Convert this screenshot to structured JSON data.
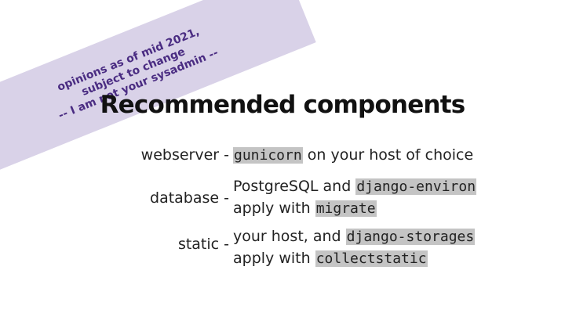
{
  "banner": {
    "line1": "opinions as of mid 2021,",
    "line2": "subject to change",
    "line3": "-- I am not your sysadmin --"
  },
  "title": "Recommended components",
  "rows": [
    {
      "label": "webserver -",
      "code1": "gunicorn",
      "text1": " on your host of choice"
    },
    {
      "label": "database -",
      "text1": "PostgreSQL and ",
      "code1": "django-environ",
      "text2": "apply with ",
      "code2": "migrate"
    },
    {
      "label": "static -",
      "text1": "your host, and ",
      "code1": "django-storages",
      "text2": "apply with ",
      "code2": "collectstatic"
    }
  ],
  "colors": {
    "banner_bg": "#d9d2e8",
    "banner_text": "#4a2c82",
    "code_highlight": "#c4c4c4"
  }
}
